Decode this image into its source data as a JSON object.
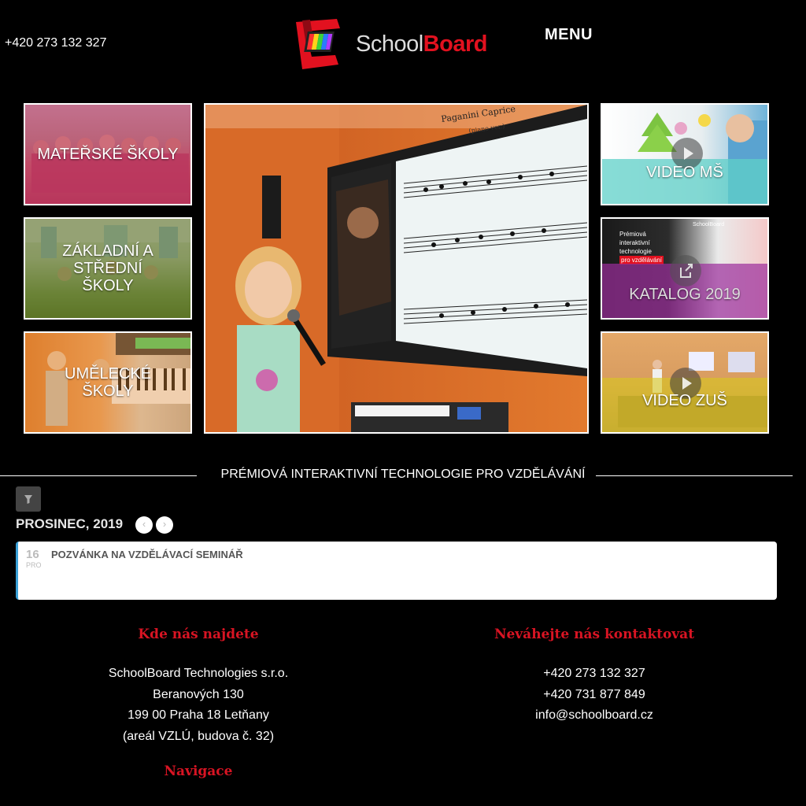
{
  "header": {
    "phone": "+420 273 132 327",
    "logo_school": "School",
    "logo_board": "Board",
    "menu_label": "MENU"
  },
  "tiles": {
    "materske": "MATEŘSKÉ ŠKOLY",
    "zakladni": "ZÁKLADNÍ A STŘEDNÍ ŠKOLY",
    "umelecke": "UMĚLECKÉ ŠKOLY",
    "video_ms": "VIDEO MŠ",
    "katalog": "KATALOG 2019",
    "video_zus": "VIDEO ZUŠ",
    "katalog_cover_lines": [
      "Prémiová",
      "interaktivní",
      "technologie",
      "pro vzdělávání"
    ],
    "katalog_cover_brand": "SchoolBoard"
  },
  "hero": {
    "sheet_title": "Paganini Caprice",
    "sheet_subtitle": "(piano ver.)"
  },
  "tagline": "PRÉMIOVÁ INTERAKTIVNÍ TECHNOLOGIE PRO VZDĚLÁVÁNÍ",
  "calendar": {
    "month": "PROSINEC, 2019",
    "prev": "‹",
    "next": "›",
    "event": {
      "day": "16",
      "month_abbr": "PRO",
      "title": "POZVÁNKA NA VZDĚLÁVACÍ SEMINÁŘ"
    }
  },
  "footer": {
    "find_us_heading": "Kde nás najdete",
    "address": [
      "SchoolBoard Technologies s.r.o.",
      "Beranových 130",
      "199 00 Praha 18 Letňany",
      "(areál VZLÚ, budova č. 32)"
    ],
    "contact_heading": "Neváhejte nás kontaktovat",
    "contact": [
      "+420 273 132 327",
      "+420 731 877 849",
      "info@schoolboard.cz"
    ],
    "nav_heading": "Navigace"
  },
  "colors": {
    "brand_red": "#e2111f",
    "heading_red": "#d81423",
    "overlay_pink": "#b0174a",
    "overlay_green": "#4e6a1c",
    "overlay_orange": "#e88a2a",
    "overlay_teal": "#5fd0c8",
    "overlay_purple": "#9b2c9b",
    "overlay_yellow": "#d8c81e"
  }
}
